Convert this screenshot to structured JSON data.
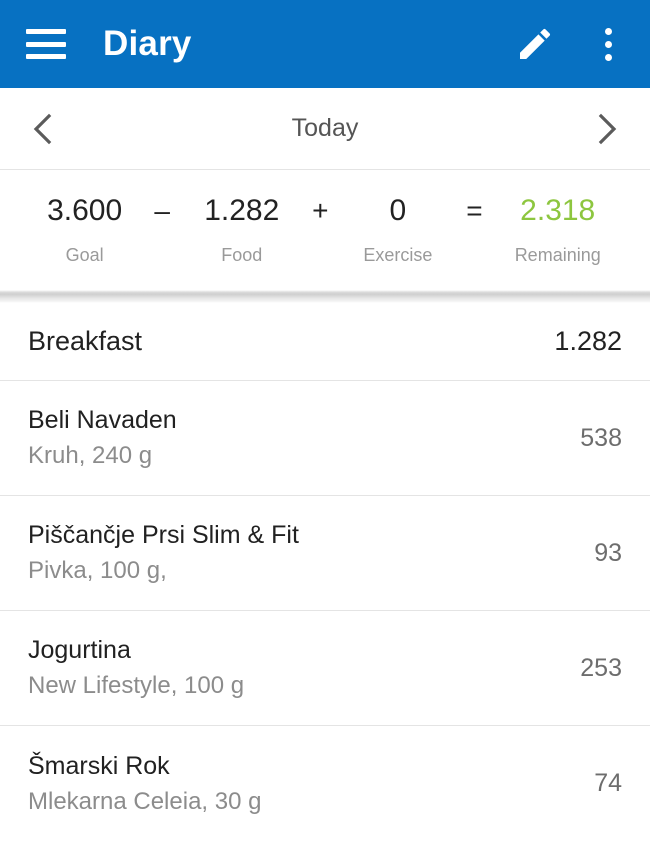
{
  "toolbar": {
    "menu_icon": "hamburger-menu-icon",
    "title": "Diary",
    "edit_icon": "pencil-edit-icon",
    "overflow_icon": "more-vertical-icon",
    "background_color": "#0771c2"
  },
  "datebar": {
    "prev_icon": "chevron-left-icon",
    "date_label": "Today",
    "next_icon": "chevron-right-icon"
  },
  "summary": {
    "goal": {
      "value": "3.600",
      "label": "Goal"
    },
    "op_minus": "–",
    "food": {
      "value": "1.282",
      "label": "Food"
    },
    "op_plus": "+",
    "exercise": {
      "value": "0",
      "label": "Exercise"
    },
    "op_equals": "=",
    "remaining": {
      "value": "2.318",
      "label": "Remaining",
      "color": "#8dc63f"
    }
  },
  "meal": {
    "name": "Breakfast",
    "total": "1.282",
    "entries": [
      {
        "title": "Beli Navaden",
        "subtitle": "Kruh, 240 g",
        "calories": "538"
      },
      {
        "title": "Piščančje Prsi Slim & Fit",
        "subtitle": "Pivka, 100 g,",
        "calories": "93"
      },
      {
        "title": "Jogurtina",
        "subtitle": "New Lifestyle, 100 g",
        "calories": "253"
      },
      {
        "title": "Šmarski Rok",
        "subtitle": "Mlekarna Celeia, 30 g",
        "calories": "74"
      }
    ]
  }
}
